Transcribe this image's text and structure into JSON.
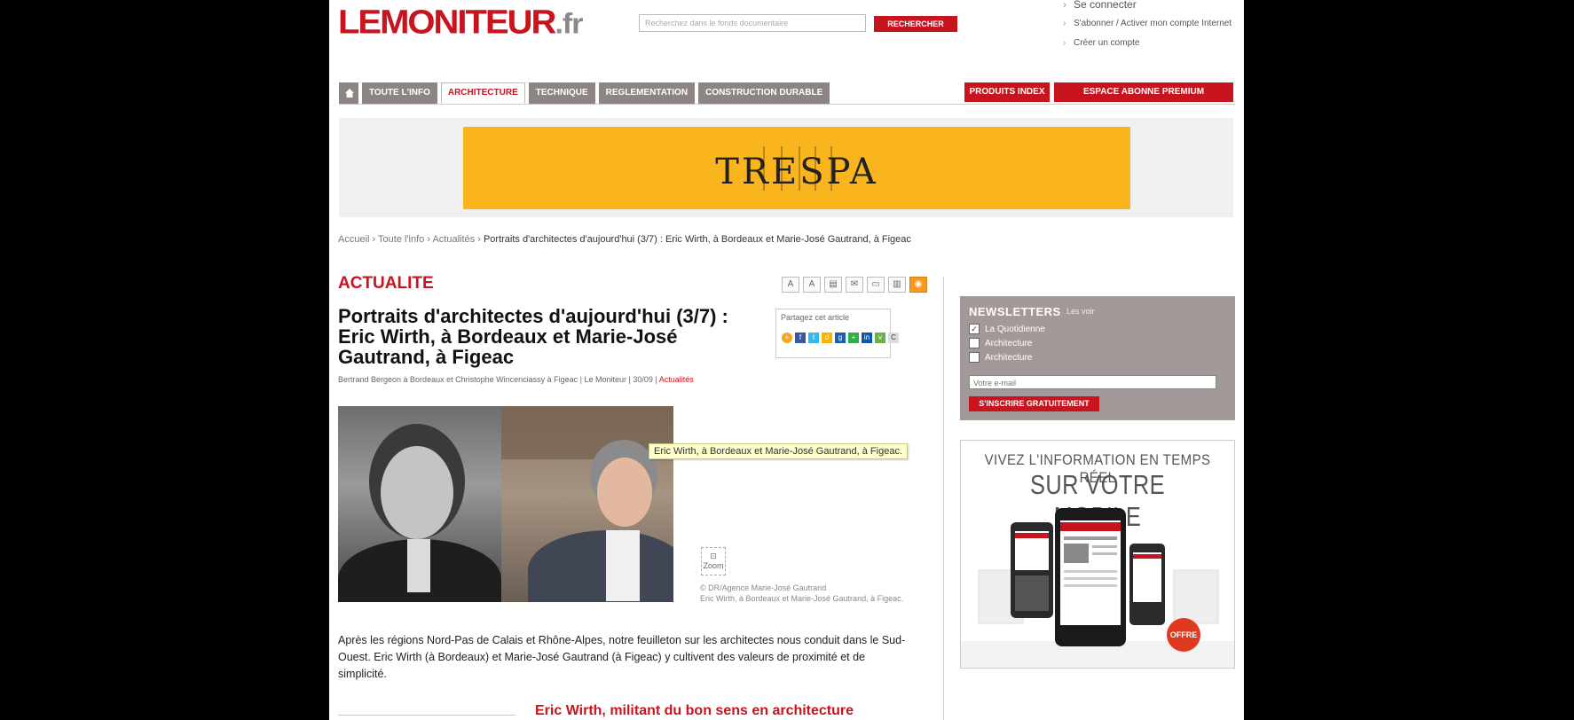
{
  "header": {
    "logo_main": "LEMONITEUR",
    "logo_tld": ".fr",
    "search_placeholder": "Recherchez dans le fonds documentaire",
    "search_button": "RECHERCHER",
    "top_links": [
      "Se connecter",
      "S'abonner / Activer mon compte Internet",
      "Créer un compte"
    ]
  },
  "nav": {
    "tabs": [
      "TOUTE L'INFO",
      "ARCHITECTURE",
      "TECHNIQUE",
      "REGLEMENTATION",
      "CONSTRUCTION DURABLE"
    ],
    "active_tab": "ARCHITECTURE",
    "right_tabs": [
      "PRODUITS INDEX",
      "ESPACE ABONNE PREMIUM"
    ]
  },
  "banner": {
    "brand": "TRESPA"
  },
  "breadcrumb": {
    "path": [
      "Accueil",
      "Toute l'info",
      "Actualités"
    ],
    "current": "Portraits d'architectes d'aujourd'hui (3/7) : Eric Wirth, à Bordeaux et Marie-José Gautrand, à Figeac"
  },
  "article": {
    "section": "ACTUALITE",
    "title": "Portraits d'architectes d'aujourd'hui (3/7) : Eric Wirth, à Bordeaux et Marie-José Gautrand, à Figeac",
    "byline": "Bertrand Bergeon à Bordeaux et Christophe Wincenciassy à Figeac | Le Moniteur | 30/09 |",
    "date": "Actualités",
    "tooltip": "Eric Wirth, à Bordeaux et Marie-José Gautrand, à Figeac.",
    "zoom_label": "Zoom",
    "caption_line1": "© DR/Agence Marie-José Gautrand",
    "caption_line2": "Eric Wirth, à Bordeaux et Marie-José Gautrand, à Figeac.",
    "body": "Après les régions Nord-Pas de Calais et Rhône-Alpes, notre feuilleton sur les architectes nous conduit dans le Sud-Ouest. Eric Wirth (à Bordeaux) et Marie-José Gautrand (à Figeac) y cultivent des valeurs de proximité et de simplicité.",
    "subheading": "Eric Wirth, militant du bon sens en architecture",
    "share_title": "Partagez cet article",
    "tools": [
      "A+",
      "A-",
      "print",
      "mail",
      "save",
      "pdf",
      "rss"
    ]
  },
  "newsletter": {
    "title": "NEWSLETTERS",
    "more": "Les voir",
    "options": [
      {
        "label": "La Quotidienne",
        "checked": true
      },
      {
        "label": "Architecture",
        "checked": false
      },
      {
        "label": "Architecture",
        "checked": false
      }
    ],
    "email_placeholder": "Votre e-mail",
    "submit": "S'INSCRIRE GRATUITEMENT"
  },
  "mobile_ad": {
    "line1": "VIVEZ L'INFORMATION EN TEMPS RÉEL",
    "line2": "SUR VOTRE MOBILE",
    "badge": "OFFRE"
  }
}
